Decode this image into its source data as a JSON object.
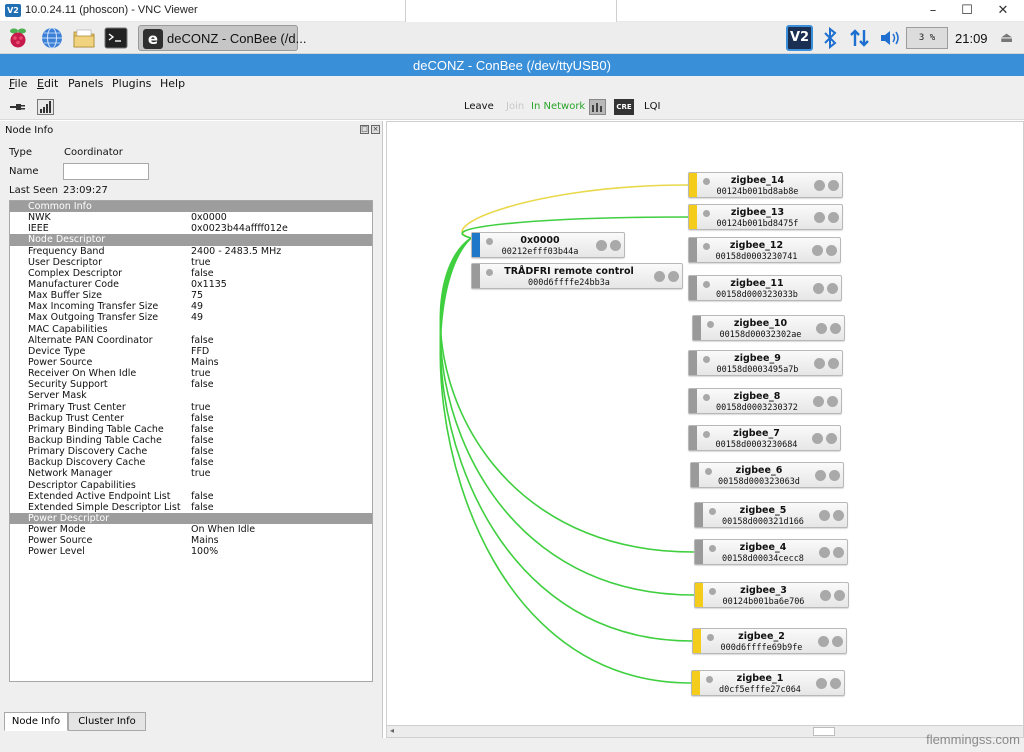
{
  "vnc": {
    "title": "10.0.24.11 (phoscon) - VNC Viewer",
    "logo": "V2"
  },
  "window_controls": [
    "–",
    "☐",
    "✕"
  ],
  "panel": {
    "task_icon": "e",
    "task_label": "deCONZ - ConBee (/d...",
    "vnc_tray": "V2",
    "cpu": "3 %",
    "clock": "21:09",
    "icons": [
      "raspberry-menu-icon",
      "web-browser-icon",
      "file-manager-icon",
      "terminal-icon",
      "bluetooth-icon",
      "network-icon",
      "volume-icon",
      "eject-icon"
    ]
  },
  "app": {
    "title": "deCONZ - ConBee (/dev/ttyUSB0)"
  },
  "menu": [
    {
      "label": "File",
      "u": "F",
      "rest": "ile"
    },
    {
      "label": "Edit",
      "u": "E",
      "rest": "dit"
    },
    {
      "label": "Panels",
      "u": "",
      "rest": "Panels"
    },
    {
      "label": "Plugins",
      "u": "",
      "rest": "Plugins"
    },
    {
      "label": "Help",
      "u": "",
      "rest": "Help"
    }
  ],
  "toolbar": {
    "leave": "Leave",
    "join": "Join",
    "in_network": "In Network",
    "cre": "CRE",
    "lqi": "LQI",
    "colors": {
      "join": "#c8c8c8",
      "in_network": "#2aa52a"
    }
  },
  "node_info": {
    "title": "Node Info",
    "type_label": "Type",
    "type_value": "Coordinator",
    "name_label": "Name",
    "name_value": "",
    "last_seen_label": "Last Seen",
    "last_seen_value": "23:09:27",
    "table": [
      {
        "section": "Common Info"
      },
      {
        "k": "NWK",
        "v": "0x0000"
      },
      {
        "k": "IEEE",
        "v": "0x0023b44affff012e"
      },
      {
        "section": "Node Descriptor"
      },
      {
        "k": "Frequency Band",
        "v": "2400 - 2483.5 MHz"
      },
      {
        "k": "User Descriptor",
        "v": "true"
      },
      {
        "k": "Complex Descriptor",
        "v": "false"
      },
      {
        "k": "Manufacturer Code",
        "v": "0x1135"
      },
      {
        "k": "Max Buffer Size",
        "v": "75"
      },
      {
        "k": "Max Incoming Transfer Size",
        "v": "49"
      },
      {
        "k": "Max Outgoing Transfer Size",
        "v": "49"
      },
      {
        "k": "MAC Capabilities",
        "v": ""
      },
      {
        "k": "Alternate PAN Coordinator",
        "v": "false"
      },
      {
        "k": "Device Type",
        "v": "FFD"
      },
      {
        "k": "Power Source",
        "v": "Mains"
      },
      {
        "k": "Receiver On When Idle",
        "v": "true"
      },
      {
        "k": "Security Support",
        "v": "false"
      },
      {
        "k": "Server Mask",
        "v": ""
      },
      {
        "k": "Primary Trust Center",
        "v": "true"
      },
      {
        "k": "Backup Trust Center",
        "v": "false"
      },
      {
        "k": "Primary Binding Table Cache",
        "v": "false"
      },
      {
        "k": "Backup Binding Table Cache",
        "v": "false"
      },
      {
        "k": "Primary Discovery Cache",
        "v": "false"
      },
      {
        "k": "Backup Discovery Cache",
        "v": "false"
      },
      {
        "k": "Network Manager",
        "v": "true"
      },
      {
        "k": "Descriptor Capabilities",
        "v": ""
      },
      {
        "k": "Extended Active Endpoint List",
        "v": "false"
      },
      {
        "k": "Extended Simple Descriptor List",
        "v": "false"
      },
      {
        "section": "Power Descriptor"
      },
      {
        "k": "Power Mode",
        "v": "On When Idle"
      },
      {
        "k": "Power Source",
        "v": "Mains"
      },
      {
        "k": "Power Level",
        "v": "100%"
      }
    ],
    "tabs": [
      "Node Info",
      "Cluster Info"
    ]
  },
  "graph": {
    "colors": {
      "coordinator": "#1f77c9",
      "router": "#f4cc1c",
      "end_device": "#9a9a9a",
      "link_green": "#3fcf3f",
      "link_yellow": "#e8d84a"
    },
    "nodes": [
      {
        "id": "coord",
        "name": "0x0000",
        "addr": "00212efff03b44a",
        "kind": "coordinator"
      },
      {
        "id": "tradfri",
        "name": "TRÅDFRI remote control",
        "addr": "000d6ffffe24bb3a",
        "kind": "end_device"
      },
      {
        "id": "z14",
        "name": "zigbee_14",
        "addr": "00124b001bd8ab8e",
        "kind": "router"
      },
      {
        "id": "z13",
        "name": "zigbee_13",
        "addr": "00124b001bd8475f",
        "kind": "router"
      },
      {
        "id": "z12",
        "name": "zigbee_12",
        "addr": "00158d0003230741",
        "kind": "end_device"
      },
      {
        "id": "z11",
        "name": "zigbee_11",
        "addr": "00158d000323033b",
        "kind": "end_device"
      },
      {
        "id": "z10",
        "name": "zigbee_10",
        "addr": "00158d00032302ae",
        "kind": "end_device"
      },
      {
        "id": "z9",
        "name": "zigbee_9",
        "addr": "00158d0003495a7b",
        "kind": "end_device"
      },
      {
        "id": "z8",
        "name": "zigbee_8",
        "addr": "00158d0003230372",
        "kind": "end_device"
      },
      {
        "id": "z7",
        "name": "zigbee_7",
        "addr": "00158d0003230684",
        "kind": "end_device"
      },
      {
        "id": "z6",
        "name": "zigbee_6",
        "addr": "00158d000323063d",
        "kind": "end_device"
      },
      {
        "id": "z5",
        "name": "zigbee_5",
        "addr": "00158d000321d166",
        "kind": "end_device"
      },
      {
        "id": "z4",
        "name": "zigbee_4",
        "addr": "00158d00034cecc8",
        "kind": "end_device"
      },
      {
        "id": "z3",
        "name": "zigbee_3",
        "addr": "00124b001ba6e706",
        "kind": "router"
      },
      {
        "id": "z2",
        "name": "zigbee_2",
        "addr": "000d6ffffe69b9fe",
        "kind": "router"
      },
      {
        "id": "z1",
        "name": "zigbee_1",
        "addr": "d0cf5efffe27c064",
        "kind": "router"
      }
    ],
    "links": [
      {
        "to": "z14",
        "color": "link_yellow"
      },
      {
        "to": "z13",
        "color": "link_green"
      },
      {
        "to": "z4",
        "color": "link_green"
      },
      {
        "to": "z3",
        "color": "link_green"
      },
      {
        "to": "z2",
        "color": "link_green"
      },
      {
        "to": "z1",
        "color": "link_green"
      }
    ]
  },
  "watermark": "flemmingss.com"
}
